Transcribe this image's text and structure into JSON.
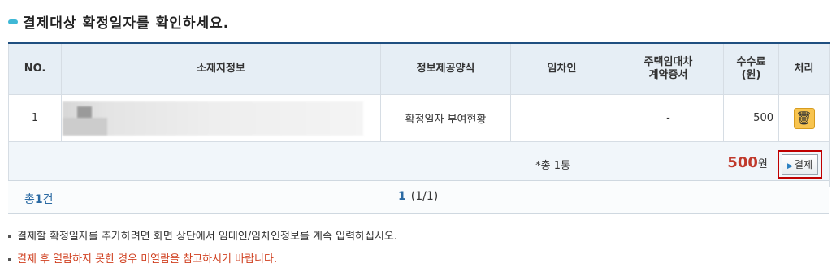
{
  "title": "결제대상 확정일자를 확인하세요.",
  "table": {
    "headers": {
      "no": "NO.",
      "location": "소재지정보",
      "method": "정보제공양식",
      "lessee": "임차인",
      "contract_line1": "주택임대차",
      "contract_line2": "계약증서",
      "fee_line1": "수수료",
      "fee_line2": "(원)",
      "action": "처리"
    },
    "rows": [
      {
        "no": "1",
        "method": "확정일자 부여현황",
        "lessee": "",
        "contract": "-",
        "fee": "500"
      }
    ],
    "summary": {
      "count_label": "*총 1통",
      "amount": "500",
      "unit": "원",
      "pay_label": "결제"
    }
  },
  "footer": {
    "total_prefix": "총",
    "total_count": "1",
    "total_suffix": "건",
    "page_current": "1",
    "page_info": "(1/1)"
  },
  "notes": [
    "결제할 확정일자를 추가하려면 화면 상단에서 임대인/임차인정보를 계속 입력하십시오.",
    "결제 후 열람하지 못한 경우 미열람을 참고하시기 바랍니다."
  ],
  "colors": {
    "accent": "#3fb8d6",
    "header_bg": "#e6eef5",
    "highlight": "#c00000",
    "amount": "#c0392b"
  }
}
